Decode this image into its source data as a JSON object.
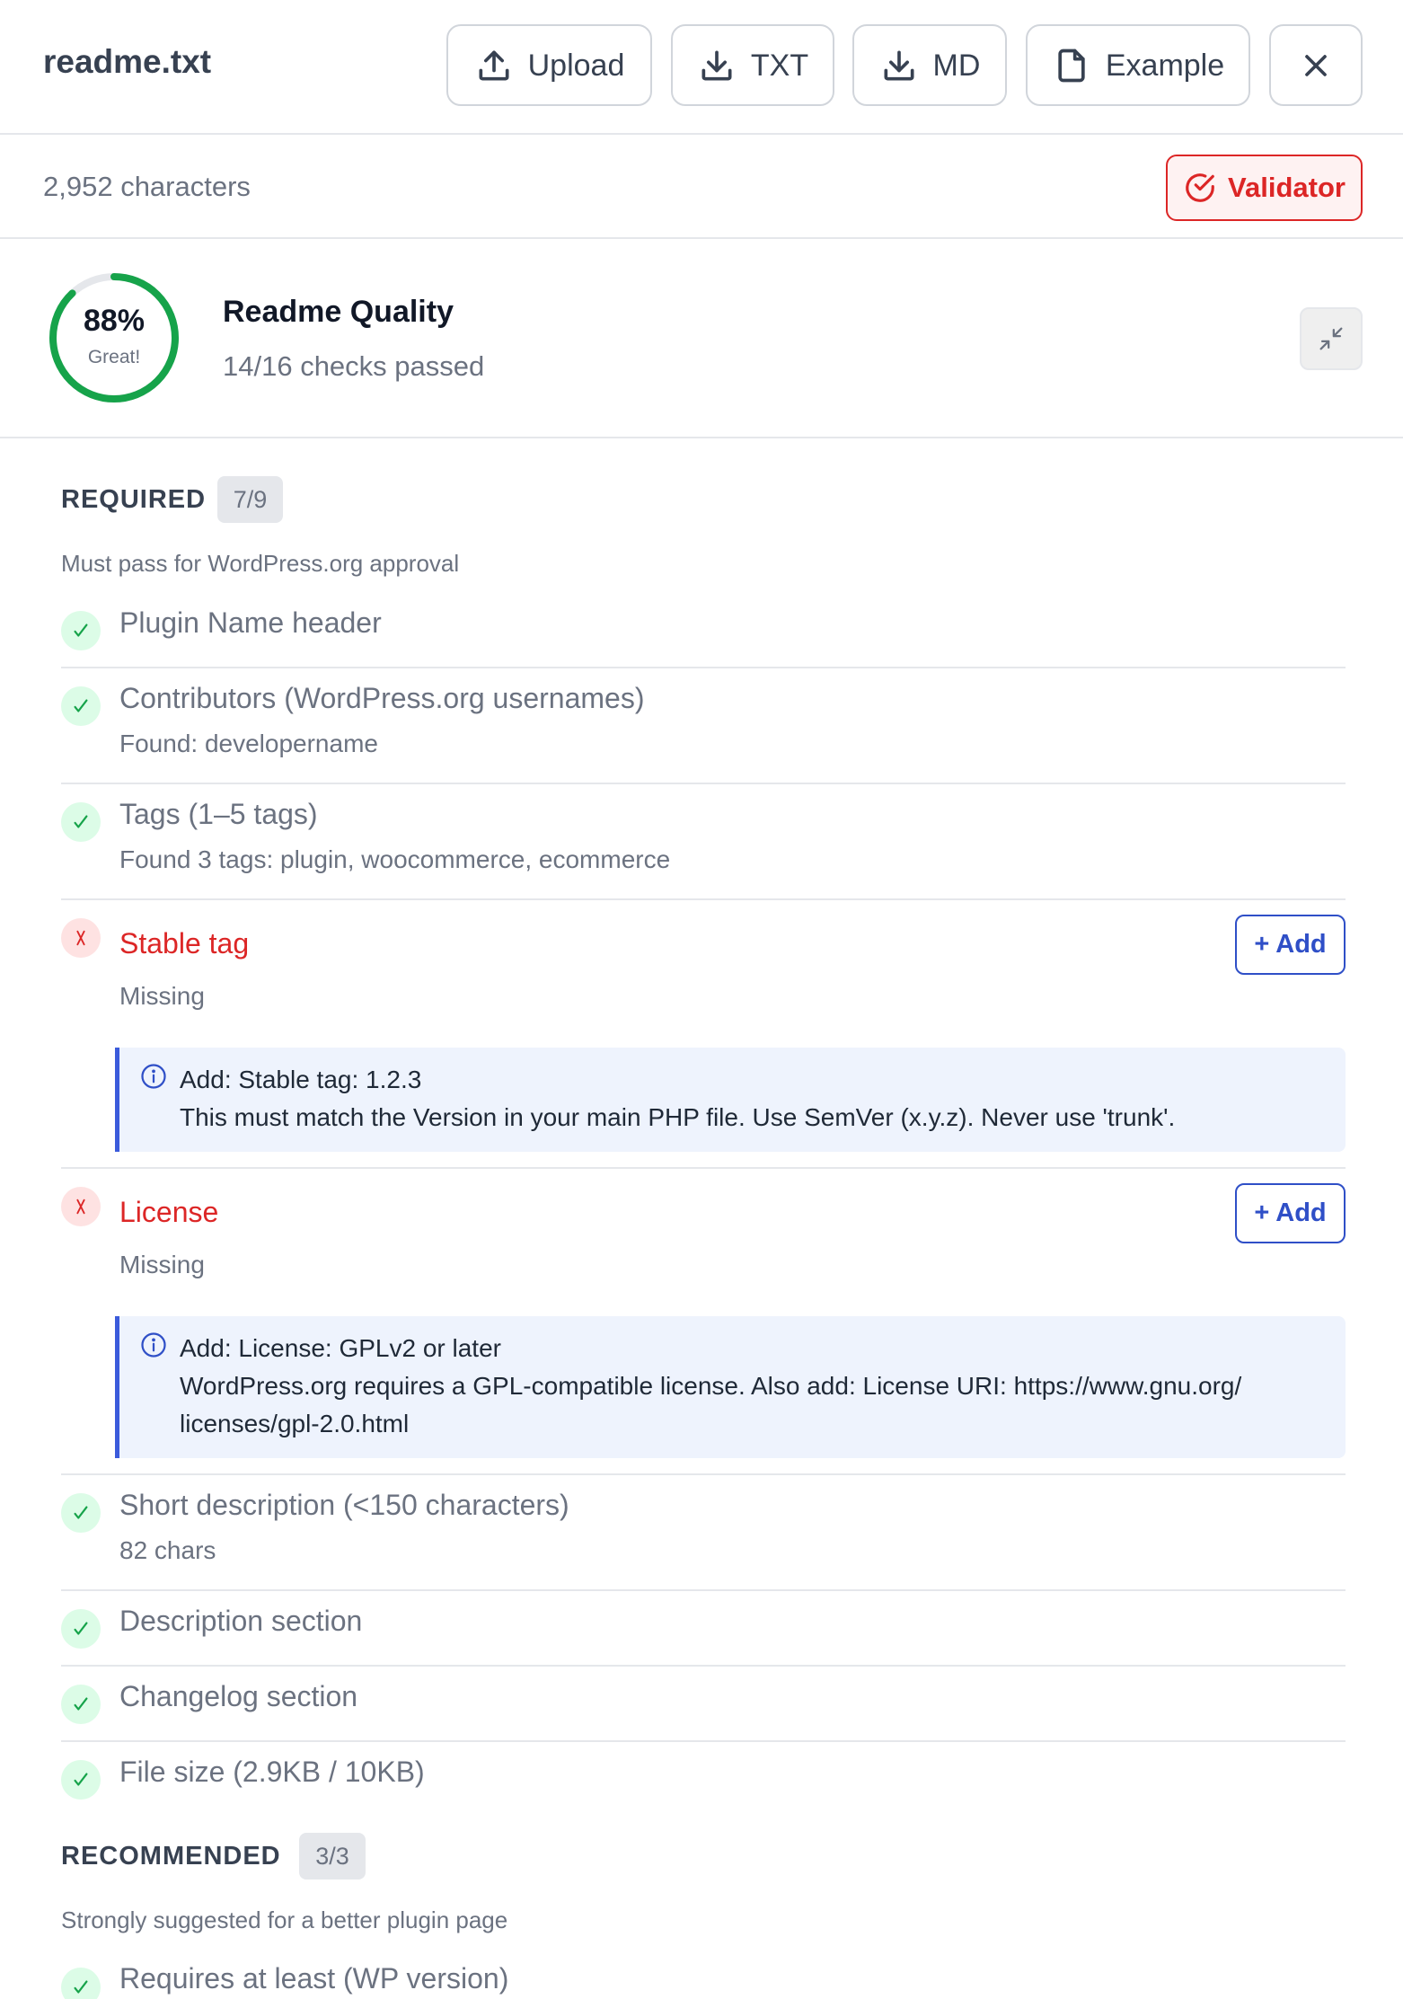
{
  "header": {
    "filename": "readme.txt",
    "buttons": {
      "upload": "Upload",
      "txt": "TXT",
      "md": "MD",
      "example": "Example"
    }
  },
  "subbar": {
    "char_count": "2,952 characters",
    "validator_label": "Validator"
  },
  "quality": {
    "score_percent": "88%",
    "score_fraction": 0.88,
    "score_label": "Great!",
    "title": "Readme Quality",
    "subtitle": "14/16 checks passed"
  },
  "colors": {
    "pass": "#16a34a",
    "fail": "#dc2626",
    "accent": "#2f4fc7",
    "hint_bg": "#eef3fd"
  },
  "required": {
    "heading": "REQUIRED",
    "badge": "7/9",
    "description": "Must pass for WordPress.org approval",
    "checks": [
      {
        "title": "Plugin Name header"
      },
      {
        "title": "Contributors (WordPress.org usernames)",
        "detail": "Found: developername"
      },
      {
        "title": "Tags (1–5 tags)",
        "detail": "Found 3 tags: plugin, woocommerce, ecommerce"
      },
      {
        "title": "Stable tag",
        "detail": "Missing",
        "add_label": "+ Add",
        "hint_line1": "Add: Stable tag: 1.2.3",
        "hint_line2": "This must match the Version in your main PHP file. Use SemVer (x.y.z). Never use 'trunk'."
      },
      {
        "title": "License",
        "detail": "Missing",
        "add_label": "+ Add",
        "hint_line1": "Add: License: GPLv2 or later",
        "hint_line2": "WordPress.org requires a GPL-compatible license. Also add: License URI: https://www.gnu.org/",
        "hint_line3": "licenses/gpl-2.0.html"
      },
      {
        "title": "Short description (<150 characters)",
        "detail": "82 chars"
      },
      {
        "title": "Description section"
      },
      {
        "title": "Changelog section"
      },
      {
        "title": "File size (2.9KB / 10KB)"
      }
    ]
  },
  "recommended": {
    "heading": "RECOMMENDED",
    "badge": "3/3",
    "description": "Strongly suggested for a better plugin page",
    "checks": [
      {
        "title": "Requires at least (WP version)"
      }
    ]
  }
}
